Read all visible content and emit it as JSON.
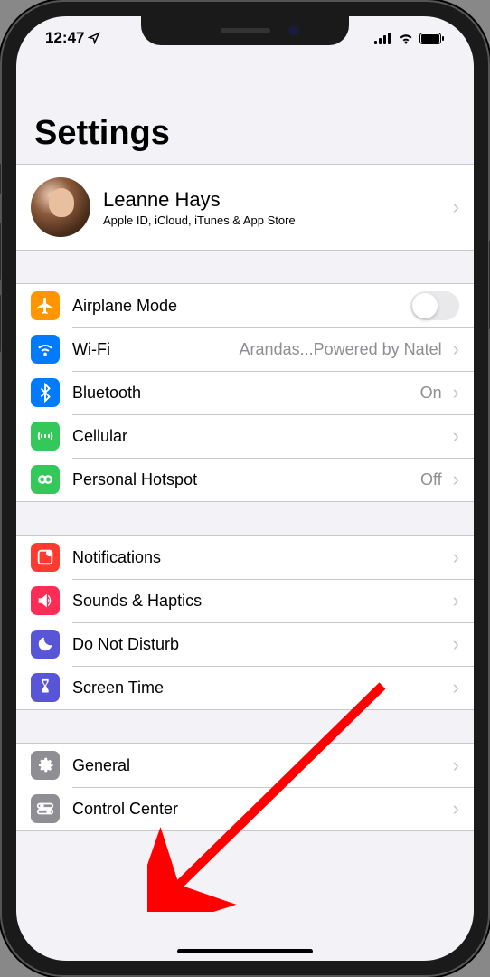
{
  "status": {
    "time": "12:47",
    "location_icon": "location-arrow-icon"
  },
  "title": "Settings",
  "profile": {
    "name": "Leanne Hays",
    "subtitle": "Apple ID, iCloud, iTunes & App Store"
  },
  "groups": [
    {
      "rows": [
        {
          "icon": "airplane-icon",
          "icon_bg": "#ff9500",
          "label": "Airplane Mode",
          "control": "toggle",
          "toggle_on": false
        },
        {
          "icon": "wifi-icon",
          "icon_bg": "#007aff",
          "label": "Wi-Fi",
          "value": "Arandas...Powered by Natel",
          "chevron": true
        },
        {
          "icon": "bluetooth-icon",
          "icon_bg": "#007aff",
          "label": "Bluetooth",
          "value": "On",
          "chevron": true
        },
        {
          "icon": "cellular-icon",
          "icon_bg": "#34c759",
          "label": "Cellular",
          "chevron": true
        },
        {
          "icon": "hotspot-icon",
          "icon_bg": "#34c759",
          "label": "Personal Hotspot",
          "value": "Off",
          "chevron": true
        }
      ]
    },
    {
      "rows": [
        {
          "icon": "notifications-icon",
          "icon_bg": "#ff3b30",
          "label": "Notifications",
          "chevron": true
        },
        {
          "icon": "sounds-icon",
          "icon_bg": "#ff2d55",
          "label": "Sounds & Haptics",
          "chevron": true
        },
        {
          "icon": "dnd-icon",
          "icon_bg": "#5856d6",
          "label": "Do Not Disturb",
          "chevron": true
        },
        {
          "icon": "screentime-icon",
          "icon_bg": "#5856d6",
          "label": "Screen Time",
          "chevron": true
        }
      ]
    },
    {
      "rows": [
        {
          "icon": "general-icon",
          "icon_bg": "#8e8e93",
          "label": "General",
          "chevron": true
        },
        {
          "icon": "control-center-icon",
          "icon_bg": "#8e8e93",
          "label": "Control Center",
          "chevron": true
        }
      ]
    }
  ],
  "annotation": {
    "arrow_color": "#ff0000"
  }
}
